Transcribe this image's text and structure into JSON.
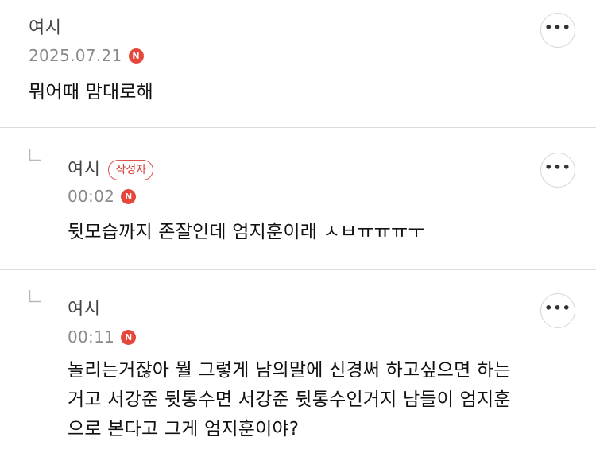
{
  "comments": [
    {
      "author": "여시",
      "timestamp": "2025.07.21",
      "new_badge": "N",
      "text": "뭐어때 맘대로해"
    },
    {
      "author": "여시",
      "writer_badge": "작성자",
      "timestamp": "00:02",
      "new_badge": "N",
      "text": "뒷모습까지 존잘인데 엄지훈이래 ㅅㅂㅠㅠㅠㅜ"
    },
    {
      "author": "여시",
      "timestamp": "00:11",
      "new_badge": "N",
      "text_lines": [
        "놀리는거잖아 뭘 그렇게 남의말에 신경써 하고싶으면 하는",
        "거고 서강준 뒷통수면 서강준 뒷통수인거지 남들이 엄지훈",
        "으로 본다고 그게 엄지훈이야?"
      ]
    }
  ],
  "more_button_label": "•••",
  "icons": {
    "more": "more-horizontal-icon",
    "reply": "reply-arrow-icon",
    "new": "new-badge-icon"
  },
  "colors": {
    "new_badge": "#e5483b",
    "writer_badge": "#d43a36",
    "divider": "#dcdcdc"
  }
}
